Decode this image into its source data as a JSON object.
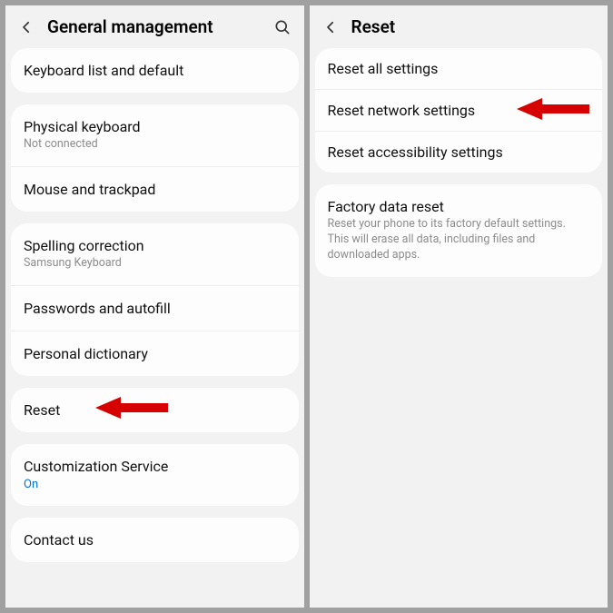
{
  "left": {
    "title": "General management",
    "groups": [
      [
        {
          "label": "Keyboard list and default"
        }
      ],
      [
        {
          "label": "Physical keyboard",
          "sub": "Not connected"
        },
        {
          "label": "Mouse and trackpad"
        }
      ],
      [
        {
          "label": "Spelling correction",
          "sub": "Samsung Keyboard"
        },
        {
          "label": "Passwords and autofill"
        },
        {
          "label": "Personal dictionary"
        }
      ],
      [
        {
          "label": "Reset"
        }
      ],
      [
        {
          "label": "Customization Service",
          "sub": "On",
          "sub_blue": true
        }
      ],
      [
        {
          "label": "Contact us"
        }
      ]
    ]
  },
  "right": {
    "title": "Reset",
    "groups": [
      [
        {
          "label": "Reset all settings"
        },
        {
          "label": "Reset network settings"
        },
        {
          "label": "Reset accessibility settings"
        }
      ],
      [
        {
          "label": "Factory data reset",
          "sub": "Reset your phone to its factory default settings. This will erase all data, including files and downloaded apps."
        }
      ]
    ]
  }
}
